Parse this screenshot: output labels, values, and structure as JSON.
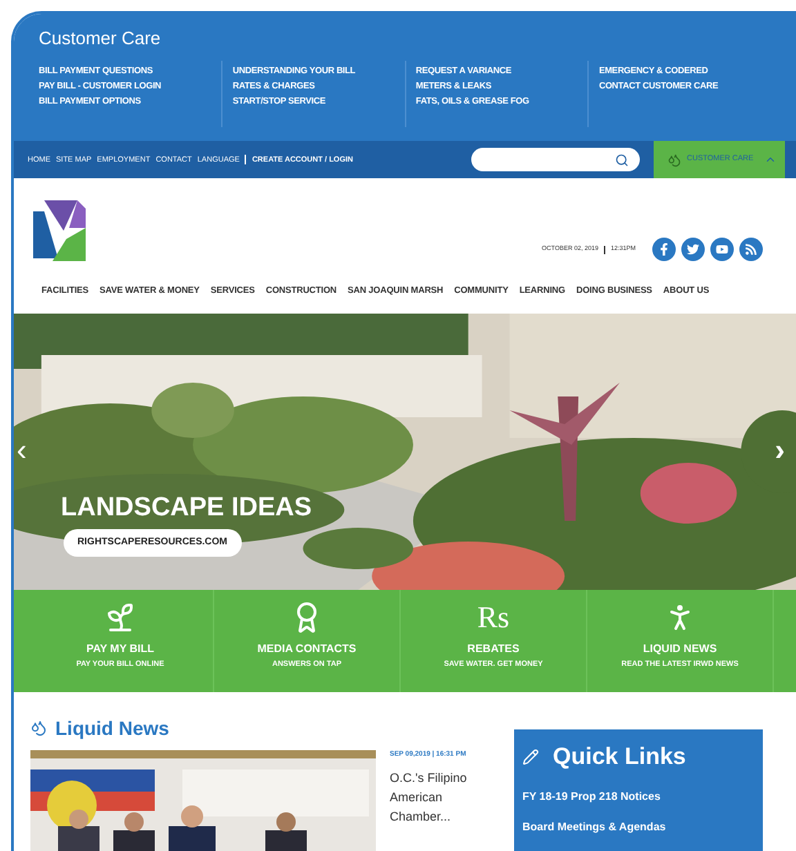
{
  "top_menu": {
    "title": "Customer Care",
    "columns": [
      {
        "links": [
          "BILL PAYMENT QUESTIONS",
          "PAY BILL - CUSTOMER LOGIN",
          "BILL PAYMENT OPTIONS"
        ]
      },
      {
        "links": [
          "UNDERSTANDING YOUR BILL",
          "RATES & CHARGES",
          "START/STOP SERVICE"
        ]
      },
      {
        "links": [
          "REQUEST A VARIANCE",
          "METERS & LEAKS",
          "FATS, OILS & GREASE FOG"
        ]
      },
      {
        "links": [
          "EMERGENCY & CODERED",
          "CONTACT CUSTOMER CARE"
        ]
      }
    ]
  },
  "utility_bar": {
    "links": [
      {
        "label": "HOME",
        "bold": false
      },
      {
        "label": "SITE MAP",
        "bold": false
      },
      {
        "label": "EMPLOYMENT",
        "bold": false
      },
      {
        "label": "CONTACT",
        "bold": false
      },
      {
        "label": "LANGUAGE",
        "bold": false
      },
      {
        "label": "CREATE ACCOUNT / LOGIN",
        "bold": true
      }
    ],
    "customer_care": {
      "label": "CUSTOMER CARE",
      "expanded": true
    }
  },
  "header": {
    "date": "OCTOBER 02, 2019",
    "time": "12:31PM"
  },
  "main_nav": [
    "FACILITIES",
    "SAVE WATER & MONEY",
    "SERVICES",
    "CONSTRUCTION",
    "SAN JOAQUIN MARSH",
    "COMMUNITY",
    "LEARNING",
    "DOING BUSINESS",
    "ABOUT US"
  ],
  "hero": {
    "title": "LANDSCAPE IDEAS",
    "button": "RIGHTSCAPERESOURCES.COM",
    "prev": "‹",
    "next": "›"
  },
  "tiles": [
    {
      "kind": "plant",
      "title": "PAY MY BILL",
      "subtitle": "PAY YOUR BILL ONLINE"
    },
    {
      "kind": "award",
      "title": "MEDIA CONTACTS",
      "subtitle": "ANSWERS ON TAP"
    },
    {
      "kind": "glyph",
      "glyph": "Rs",
      "title": "REBATES",
      "subtitle": "SAVE WATER. GET MONEY"
    },
    {
      "kind": "person",
      "title": "LIQUID NEWS",
      "subtitle": "READ THE LATEST IRWD NEWS"
    }
  ],
  "news": {
    "heading": "Liquid News",
    "date": "SEP 09,2019 | 16:31 PM",
    "headline": "O.C.'s Filipino American Chamber..."
  },
  "quick_links": {
    "heading": "Quick Links",
    "links": [
      "FY 18-19 Prop 218 Notices",
      "Board Meetings & Agendas"
    ]
  }
}
